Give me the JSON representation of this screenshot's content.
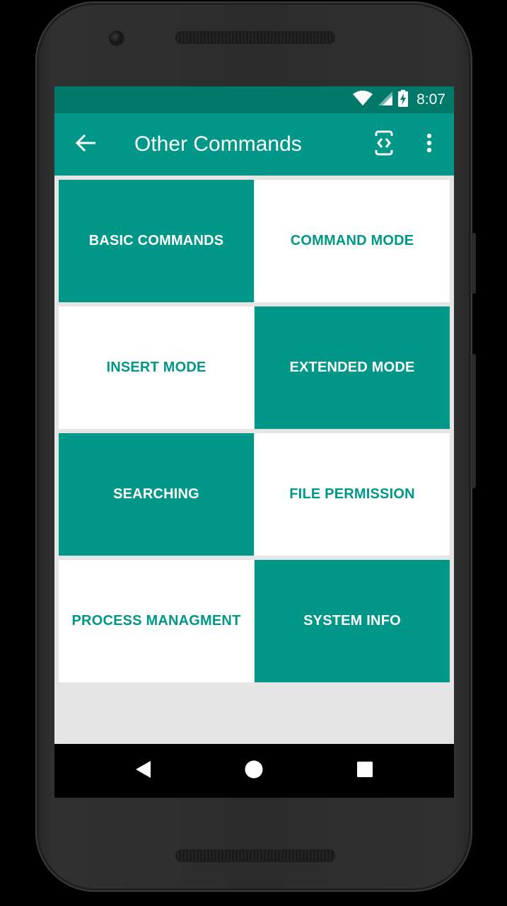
{
  "status_bar": {
    "time": "8:07",
    "icons": [
      "wifi-icon",
      "cell-signal-icon",
      "battery-charging-icon"
    ]
  },
  "app_bar": {
    "title": "Other Commands",
    "back_icon": "arrow-left-icon",
    "toggle_icon": "screen-rotation-icon",
    "more_icon": "more-vertical-icon"
  },
  "tiles": [
    {
      "label": "BASIC COMMANDS",
      "style": "filled"
    },
    {
      "label": "COMMAND MODE",
      "style": "outlined"
    },
    {
      "label": "INSERT MODE",
      "style": "outlined"
    },
    {
      "label": "EXTENDED MODE",
      "style": "filled"
    },
    {
      "label": "SEARCHING",
      "style": "filled"
    },
    {
      "label": "FILE PERMISSION",
      "style": "outlined"
    },
    {
      "label": "PROCESS MANAGMENT",
      "style": "outlined"
    },
    {
      "label": "SYSTEM INFO",
      "style": "filled"
    }
  ],
  "nav_bar": {
    "icons": [
      "nav-back-icon",
      "nav-home-icon",
      "nav-recents-icon"
    ]
  },
  "colors": {
    "primary": "#009688",
    "primary_dark": "#00796b",
    "tile_text_light": "#ffffff",
    "screen_background": "#e5e5e5"
  }
}
